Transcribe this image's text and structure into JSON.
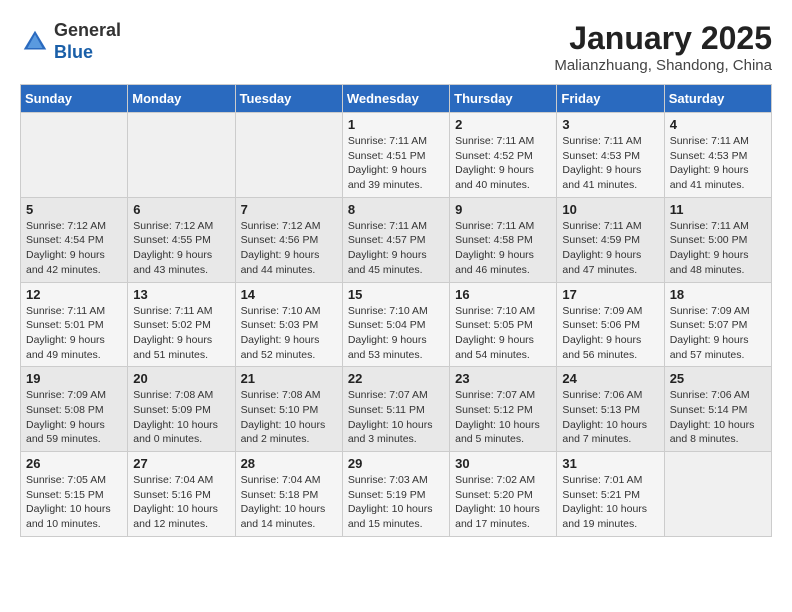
{
  "header": {
    "logo_general": "General",
    "logo_blue": "Blue",
    "month_title": "January 2025",
    "subtitle": "Malianzhuang, Shandong, China"
  },
  "days_of_week": [
    "Sunday",
    "Monday",
    "Tuesday",
    "Wednesday",
    "Thursday",
    "Friday",
    "Saturday"
  ],
  "weeks": [
    [
      {
        "day": "",
        "info": ""
      },
      {
        "day": "",
        "info": ""
      },
      {
        "day": "",
        "info": ""
      },
      {
        "day": "1",
        "info": "Sunrise: 7:11 AM\nSunset: 4:51 PM\nDaylight: 9 hours\nand 39 minutes."
      },
      {
        "day": "2",
        "info": "Sunrise: 7:11 AM\nSunset: 4:52 PM\nDaylight: 9 hours\nand 40 minutes."
      },
      {
        "day": "3",
        "info": "Sunrise: 7:11 AM\nSunset: 4:53 PM\nDaylight: 9 hours\nand 41 minutes."
      },
      {
        "day": "4",
        "info": "Sunrise: 7:11 AM\nSunset: 4:53 PM\nDaylight: 9 hours\nand 41 minutes."
      }
    ],
    [
      {
        "day": "5",
        "info": "Sunrise: 7:12 AM\nSunset: 4:54 PM\nDaylight: 9 hours\nand 42 minutes."
      },
      {
        "day": "6",
        "info": "Sunrise: 7:12 AM\nSunset: 4:55 PM\nDaylight: 9 hours\nand 43 minutes."
      },
      {
        "day": "7",
        "info": "Sunrise: 7:12 AM\nSunset: 4:56 PM\nDaylight: 9 hours\nand 44 minutes."
      },
      {
        "day": "8",
        "info": "Sunrise: 7:11 AM\nSunset: 4:57 PM\nDaylight: 9 hours\nand 45 minutes."
      },
      {
        "day": "9",
        "info": "Sunrise: 7:11 AM\nSunset: 4:58 PM\nDaylight: 9 hours\nand 46 minutes."
      },
      {
        "day": "10",
        "info": "Sunrise: 7:11 AM\nSunset: 4:59 PM\nDaylight: 9 hours\nand 47 minutes."
      },
      {
        "day": "11",
        "info": "Sunrise: 7:11 AM\nSunset: 5:00 PM\nDaylight: 9 hours\nand 48 minutes."
      }
    ],
    [
      {
        "day": "12",
        "info": "Sunrise: 7:11 AM\nSunset: 5:01 PM\nDaylight: 9 hours\nand 49 minutes."
      },
      {
        "day": "13",
        "info": "Sunrise: 7:11 AM\nSunset: 5:02 PM\nDaylight: 9 hours\nand 51 minutes."
      },
      {
        "day": "14",
        "info": "Sunrise: 7:10 AM\nSunset: 5:03 PM\nDaylight: 9 hours\nand 52 minutes."
      },
      {
        "day": "15",
        "info": "Sunrise: 7:10 AM\nSunset: 5:04 PM\nDaylight: 9 hours\nand 53 minutes."
      },
      {
        "day": "16",
        "info": "Sunrise: 7:10 AM\nSunset: 5:05 PM\nDaylight: 9 hours\nand 54 minutes."
      },
      {
        "day": "17",
        "info": "Sunrise: 7:09 AM\nSunset: 5:06 PM\nDaylight: 9 hours\nand 56 minutes."
      },
      {
        "day": "18",
        "info": "Sunrise: 7:09 AM\nSunset: 5:07 PM\nDaylight: 9 hours\nand 57 minutes."
      }
    ],
    [
      {
        "day": "19",
        "info": "Sunrise: 7:09 AM\nSunset: 5:08 PM\nDaylight: 9 hours\nand 59 minutes."
      },
      {
        "day": "20",
        "info": "Sunrise: 7:08 AM\nSunset: 5:09 PM\nDaylight: 10 hours\nand 0 minutes."
      },
      {
        "day": "21",
        "info": "Sunrise: 7:08 AM\nSunset: 5:10 PM\nDaylight: 10 hours\nand 2 minutes."
      },
      {
        "day": "22",
        "info": "Sunrise: 7:07 AM\nSunset: 5:11 PM\nDaylight: 10 hours\nand 3 minutes."
      },
      {
        "day": "23",
        "info": "Sunrise: 7:07 AM\nSunset: 5:12 PM\nDaylight: 10 hours\nand 5 minutes."
      },
      {
        "day": "24",
        "info": "Sunrise: 7:06 AM\nSunset: 5:13 PM\nDaylight: 10 hours\nand 7 minutes."
      },
      {
        "day": "25",
        "info": "Sunrise: 7:06 AM\nSunset: 5:14 PM\nDaylight: 10 hours\nand 8 minutes."
      }
    ],
    [
      {
        "day": "26",
        "info": "Sunrise: 7:05 AM\nSunset: 5:15 PM\nDaylight: 10 hours\nand 10 minutes."
      },
      {
        "day": "27",
        "info": "Sunrise: 7:04 AM\nSunset: 5:16 PM\nDaylight: 10 hours\nand 12 minutes."
      },
      {
        "day": "28",
        "info": "Sunrise: 7:04 AM\nSunset: 5:18 PM\nDaylight: 10 hours\nand 14 minutes."
      },
      {
        "day": "29",
        "info": "Sunrise: 7:03 AM\nSunset: 5:19 PM\nDaylight: 10 hours\nand 15 minutes."
      },
      {
        "day": "30",
        "info": "Sunrise: 7:02 AM\nSunset: 5:20 PM\nDaylight: 10 hours\nand 17 minutes."
      },
      {
        "day": "31",
        "info": "Sunrise: 7:01 AM\nSunset: 5:21 PM\nDaylight: 10 hours\nand 19 minutes."
      },
      {
        "day": "",
        "info": ""
      }
    ]
  ]
}
